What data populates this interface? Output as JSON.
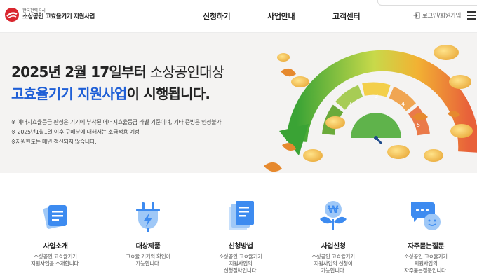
{
  "header": {
    "org": "한국전력공사",
    "site_name": "소상공인 고효율기기 지원사업",
    "nav": [
      "신청하기",
      "사업안내",
      "고객센터"
    ],
    "login": "로그인/회원가입"
  },
  "hero": {
    "line1_bold": "2025년 2월 17일부터",
    "line1_light": " 소상공인대상",
    "line2_blue": "고효율기기 지원사업",
    "line2_rest": "이 시행됩니다.",
    "notes": [
      "※ 에너지효율등급 판정은 기기에 부착된 에너지효율등급 라벨 기준이며, 기타 증빙은 인정불가",
      "※ 2025년1월1일 이후 구매분에 대해서는 소급적용 예정",
      "※지원한도는 매년 갱신되지 않습니다."
    ],
    "gauge_levels": [
      "1",
      "2",
      "3",
      "4",
      "5"
    ]
  },
  "services": [
    {
      "title": "사업소개",
      "desc": [
        "소상공인 고효율기기",
        "지원사업을 소개합니다."
      ],
      "icon": "document-icon"
    },
    {
      "title": "대상제품",
      "desc": [
        "고효율 기기의 확인이",
        "가능합니다."
      ],
      "icon": "plug-icon"
    },
    {
      "title": "신청방법",
      "desc": [
        "소상공인 고효율기기",
        "지원사업의",
        "신청절차입니다."
      ],
      "icon": "file-stack-icon"
    },
    {
      "title": "사업신청",
      "desc": [
        "소상공인 고효율기기",
        "지원사업의 신청이",
        "가능합니다."
      ],
      "icon": "won-sprout-icon"
    },
    {
      "title": "자주묻는질문",
      "desc": [
        "소상공인 고효율기기",
        "지원사업의",
        "자주묻는질문입니다."
      ],
      "icon": "chat-icon"
    }
  ],
  "colors": {
    "accent": "#1f5fd6",
    "brand_red": "#d9262e",
    "icon_blue": "#3d8bf0"
  }
}
